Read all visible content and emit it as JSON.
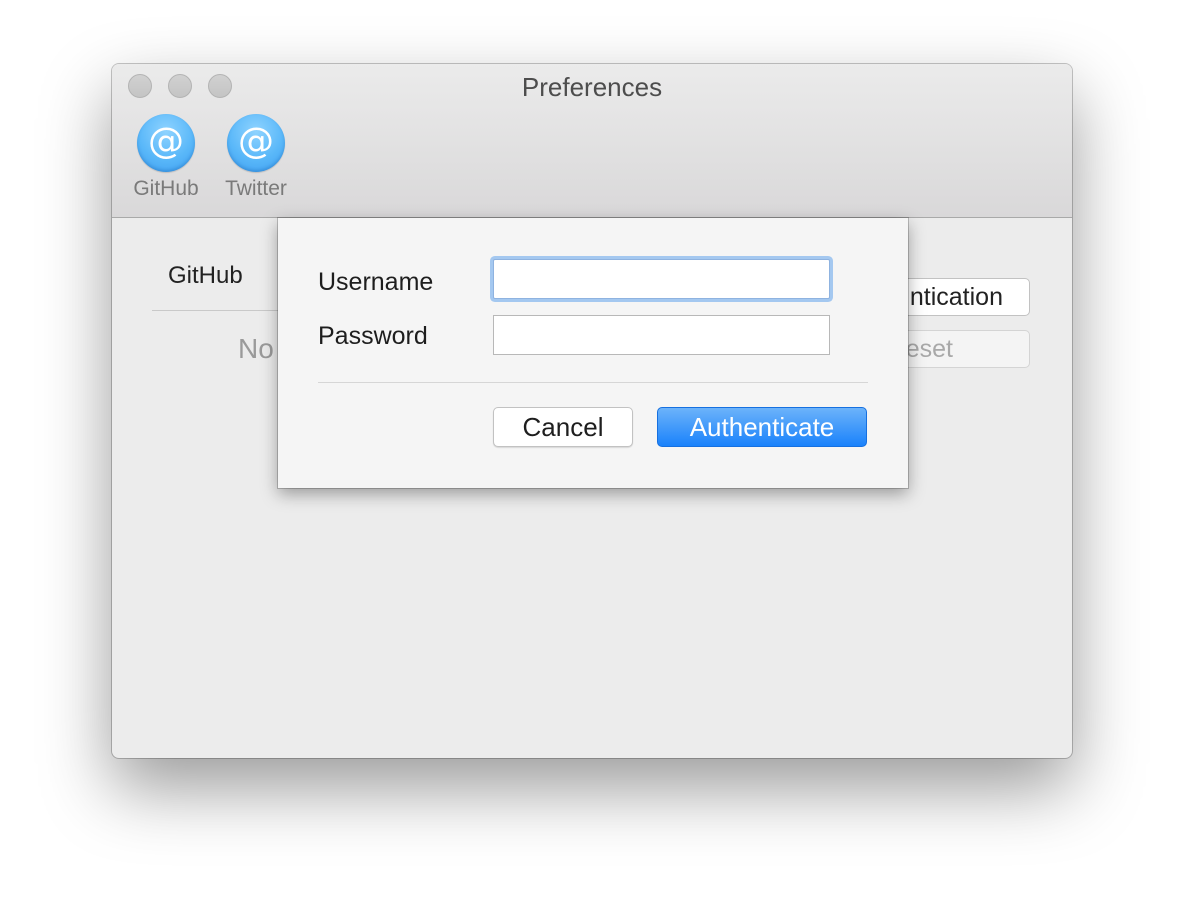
{
  "window": {
    "title": "Preferences"
  },
  "toolbar": {
    "items": [
      {
        "label": "GitHub",
        "icon": "at-icon",
        "glyph": "@"
      },
      {
        "label": "Twitter",
        "icon": "at-icon",
        "glyph": "@"
      }
    ]
  },
  "content": {
    "section_title": "GitHub",
    "status_text": "No",
    "auth_button_label": "ntication",
    "reset_button_label": "eset"
  },
  "sheet": {
    "username_label": "Username",
    "password_label": "Password",
    "username_value": "",
    "password_value": "",
    "cancel_label": "Cancel",
    "authenticate_label": "Authenticate"
  },
  "colors": {
    "accent": "#1a82fb",
    "icon": "#5ab8f9",
    "focus_ring": "#a4c8f0"
  }
}
